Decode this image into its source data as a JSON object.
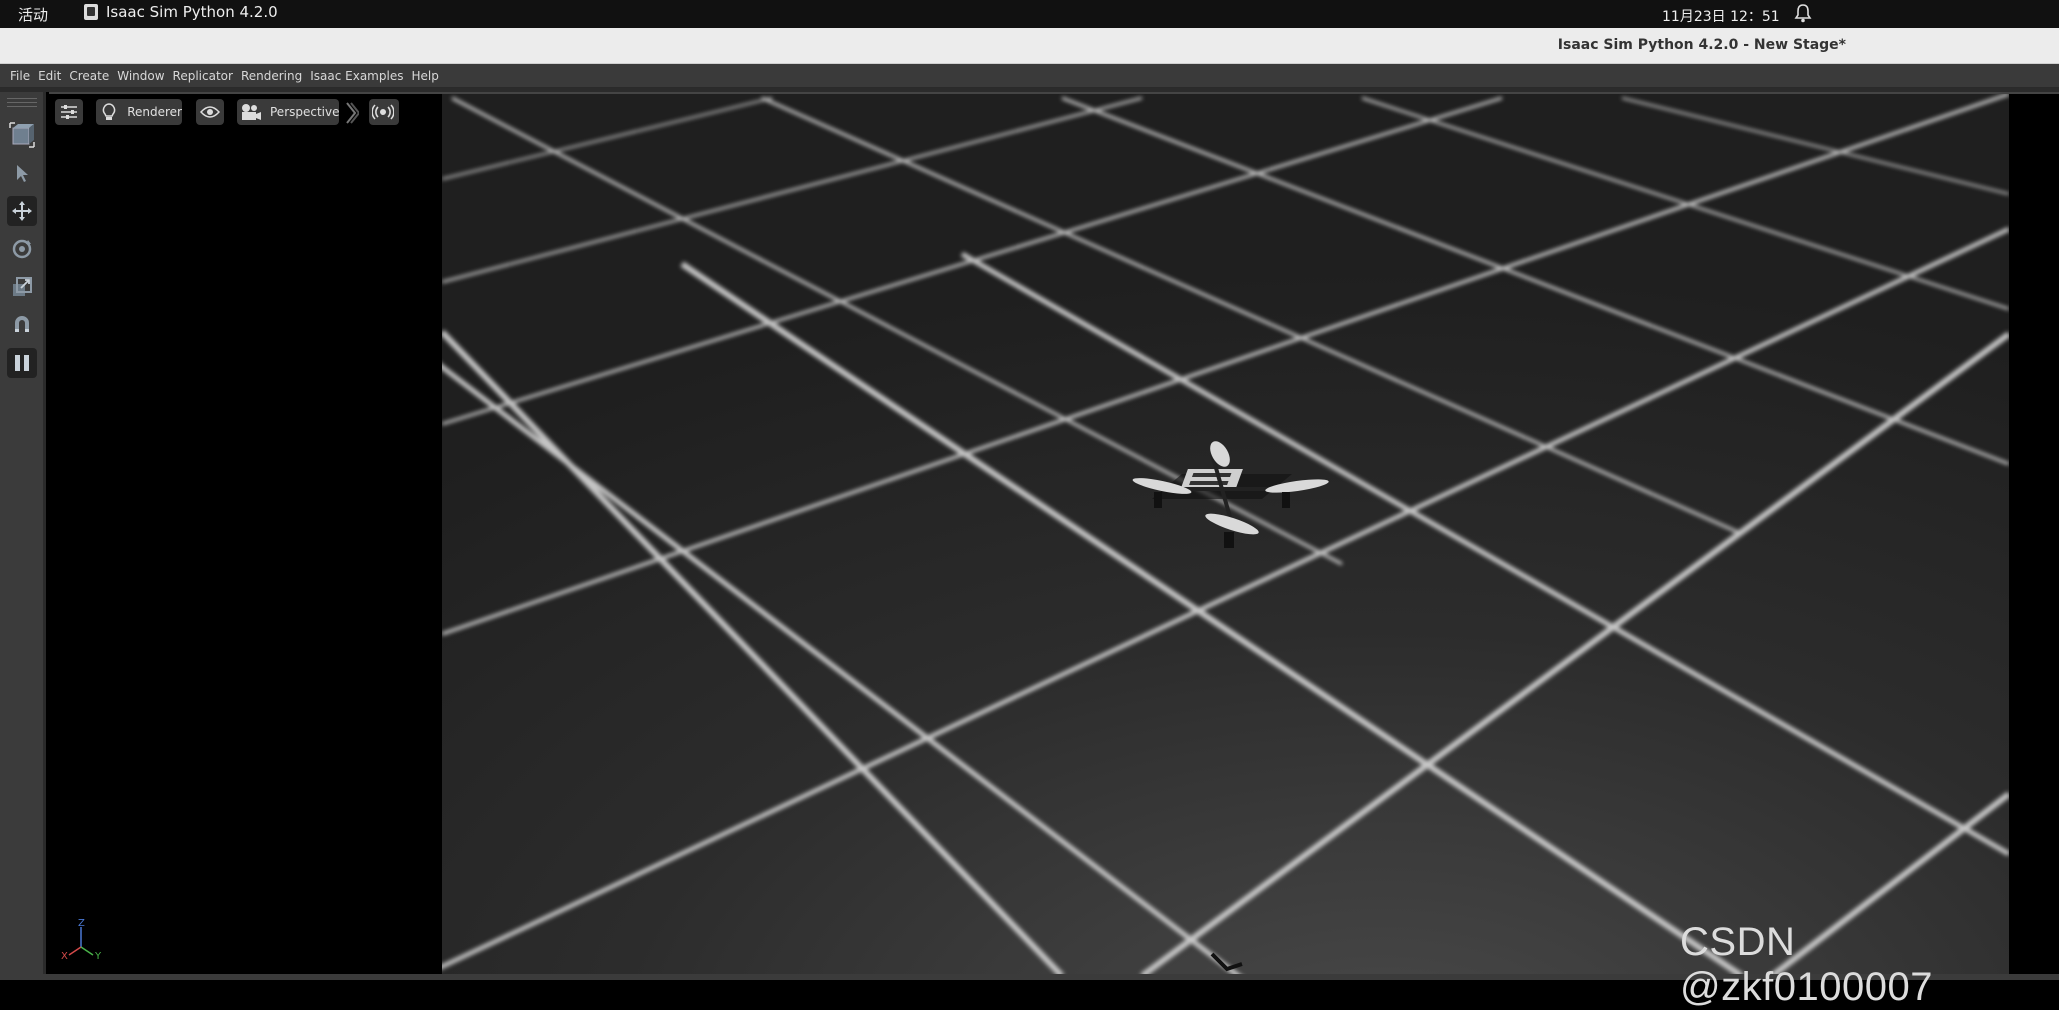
{
  "system_bar": {
    "activities_label": "活动",
    "app_name": "Isaac Sim Python 4.2.0",
    "clock": "11月23日  12：51"
  },
  "window": {
    "title": "Isaac Sim Python 4.2.0 - New Stage*"
  },
  "menu": {
    "items": [
      "File",
      "Edit",
      "Create",
      "Window",
      "Replicator",
      "Rendering",
      "Isaac Examples",
      "Help"
    ]
  },
  "left_toolbar": {
    "tools": [
      "stage-icon",
      "select-icon",
      "move-icon",
      "rotate-icon",
      "scale-icon",
      "snap-icon",
      "pause-icon"
    ],
    "active_tool": "move-icon"
  },
  "viewport": {
    "renderer_label": "Renderer",
    "camera_label": "Perspective",
    "axis_labels": {
      "x": "X",
      "y": "Y",
      "z": "Z"
    }
  },
  "watermark": "CSDN @zkf0100007",
  "colors": {
    "accent_axis_x": "#d44a4a",
    "accent_axis_y": "#4ab44a",
    "accent_axis_z": "#4a78d4",
    "menubar_bg": "#3a3a3a",
    "toolbar_bg": "#3b3b3b"
  }
}
